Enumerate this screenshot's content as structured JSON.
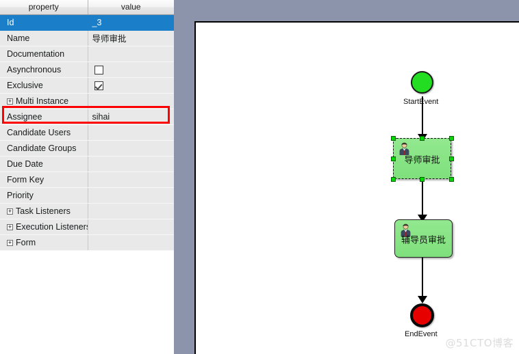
{
  "properties_panel": {
    "columns": [
      "property",
      "value"
    ],
    "rows": [
      {
        "property": "Id",
        "value": "_3",
        "type": "text",
        "selected": true,
        "expandable": false
      },
      {
        "property": "Name",
        "value": "导师审批",
        "type": "text",
        "selected": false,
        "expandable": false
      },
      {
        "property": "Documentation",
        "value": "",
        "type": "text",
        "selected": false,
        "expandable": false
      },
      {
        "property": "Asynchronous",
        "value": "",
        "type": "checkbox",
        "checked": false,
        "selected": false,
        "expandable": false
      },
      {
        "property": "Exclusive",
        "value": "",
        "type": "checkbox",
        "checked": true,
        "selected": false,
        "expandable": false
      },
      {
        "property": "Multi Instance",
        "value": "",
        "type": "text",
        "selected": false,
        "expandable": true
      },
      {
        "property": "Assignee",
        "value": "sihai",
        "type": "text",
        "selected": false,
        "expandable": false,
        "highlighted": true
      },
      {
        "property": "Candidate Users",
        "value": "",
        "type": "text",
        "selected": false,
        "expandable": false
      },
      {
        "property": "Candidate Groups",
        "value": "",
        "type": "text",
        "selected": false,
        "expandable": false
      },
      {
        "property": "Due Date",
        "value": "",
        "type": "text",
        "selected": false,
        "expandable": false
      },
      {
        "property": "Form Key",
        "value": "",
        "type": "text",
        "selected": false,
        "expandable": false
      },
      {
        "property": "Priority",
        "value": "",
        "type": "text",
        "selected": false,
        "expandable": false
      },
      {
        "property": "Task Listeners",
        "value": "",
        "type": "text",
        "selected": false,
        "expandable": true
      },
      {
        "property": "Execution Listeners",
        "value": "",
        "type": "text",
        "selected": false,
        "expandable": true
      },
      {
        "property": "Form",
        "value": "",
        "type": "text",
        "selected": false,
        "expandable": true
      }
    ],
    "expander_glyph": "+",
    "highlight_color": "#ff0000",
    "selection_color": "#1a7ec8"
  },
  "diagram": {
    "nodes": [
      {
        "id": "startevent",
        "kind": "start-event",
        "label": "StartEvent",
        "color": "#22dd22"
      },
      {
        "id": "task1",
        "kind": "user-task",
        "label": "导师审批",
        "color": "#7fe07c",
        "selected": true,
        "icon": "user-task-icon"
      },
      {
        "id": "task2",
        "kind": "user-task",
        "label": "辅导员审批",
        "color": "#7fe07c",
        "selected": false,
        "icon": "user-task-icon"
      },
      {
        "id": "endevent",
        "kind": "end-event",
        "label": "EndEvent",
        "color": "#e60000"
      }
    ],
    "flows": [
      {
        "from": "startevent",
        "to": "task1"
      },
      {
        "from": "task1",
        "to": "task2"
      },
      {
        "from": "task2",
        "to": "endevent"
      }
    ],
    "canvas_background": "#ffffff",
    "gutter_color": "#8c94ac"
  },
  "watermark": {
    "text": "@51CTO博客"
  }
}
